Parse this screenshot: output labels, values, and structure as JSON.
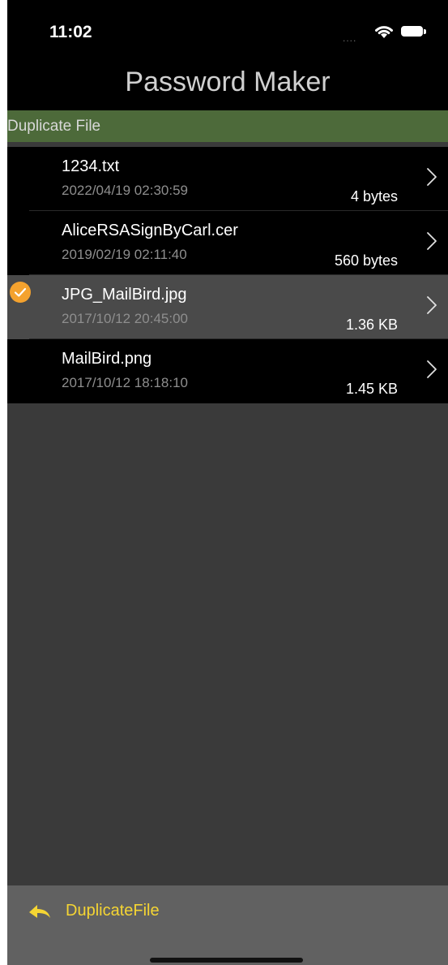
{
  "status_bar": {
    "time": "11:02",
    "signal": "....",
    "icons": [
      "wifi-icon",
      "battery-icon"
    ]
  },
  "nav": {
    "title": "Password Maker"
  },
  "section": {
    "title": "Duplicate File"
  },
  "files": [
    {
      "name": "1234.txt",
      "date": "2022/04/19  02:30:59",
      "size": "4 bytes",
      "selected": false
    },
    {
      "name": "AliceRSASignByCarl.cer",
      "date": "2019/02/19  02:11:40",
      "size": "560 bytes",
      "selected": false
    },
    {
      "name": "JPG_MailBird.jpg",
      "date": "2017/10/12  20:45:00",
      "size": "1.36 KB",
      "selected": true
    },
    {
      "name": "MailBird.png",
      "date": "2017/10/12  18:18:10",
      "size": "1.45 KB",
      "selected": false
    }
  ],
  "toolbar": {
    "back_label": "DuplicateFile"
  },
  "colors": {
    "section_bg": "#4d6a3a",
    "selected_row_bg": "#4a4a4a",
    "check_badge": "#f4a22e",
    "toolbar_accent": "#f5d533"
  }
}
